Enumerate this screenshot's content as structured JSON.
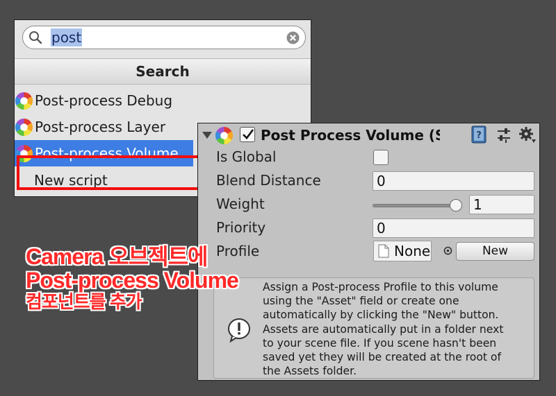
{
  "search": {
    "query": "post"
  },
  "popup": {
    "header": "Search",
    "items": [
      {
        "label": "Post-process Debug",
        "icon": "post-process-icon",
        "selected": false
      },
      {
        "label": "Post-process Layer",
        "icon": "post-process-icon",
        "selected": false
      },
      {
        "label": "Post-process Volume",
        "icon": "post-process-icon",
        "selected": true
      },
      {
        "label": "New script",
        "icon": "",
        "selected": false
      }
    ],
    "highlight_color": "#f20d0d",
    "selected_color": "#3e7de3"
  },
  "inspector": {
    "title": "Post Process Volume (Sc",
    "enabled": true,
    "properties": {
      "is_global_label": "Is Global",
      "is_global": false,
      "blend_distance_label": "Blend Distance",
      "blend_distance": "0",
      "weight_label": "Weight",
      "weight": "1",
      "weight_fraction": 1,
      "priority_label": "Priority",
      "priority": "0",
      "profile_label": "Profile",
      "profile_value": "None",
      "new_button": "New"
    },
    "help_lines": [
      "Assign a Post-process Profile to this volume",
      "using the \"Asset\" field or create one",
      "automatically by clicking the \"New\" button.",
      "Assets are automatically put in a folder next",
      "to your scene file. If you scene hasn't been",
      "saved yet they will be created at the root of",
      "the Assets folder."
    ]
  },
  "annotation": {
    "line1": "Camera 오브젝트에",
    "line2": "Post-process Volume",
    "line3": "컴포넌트를 추가",
    "color": "#ff2a2a"
  }
}
